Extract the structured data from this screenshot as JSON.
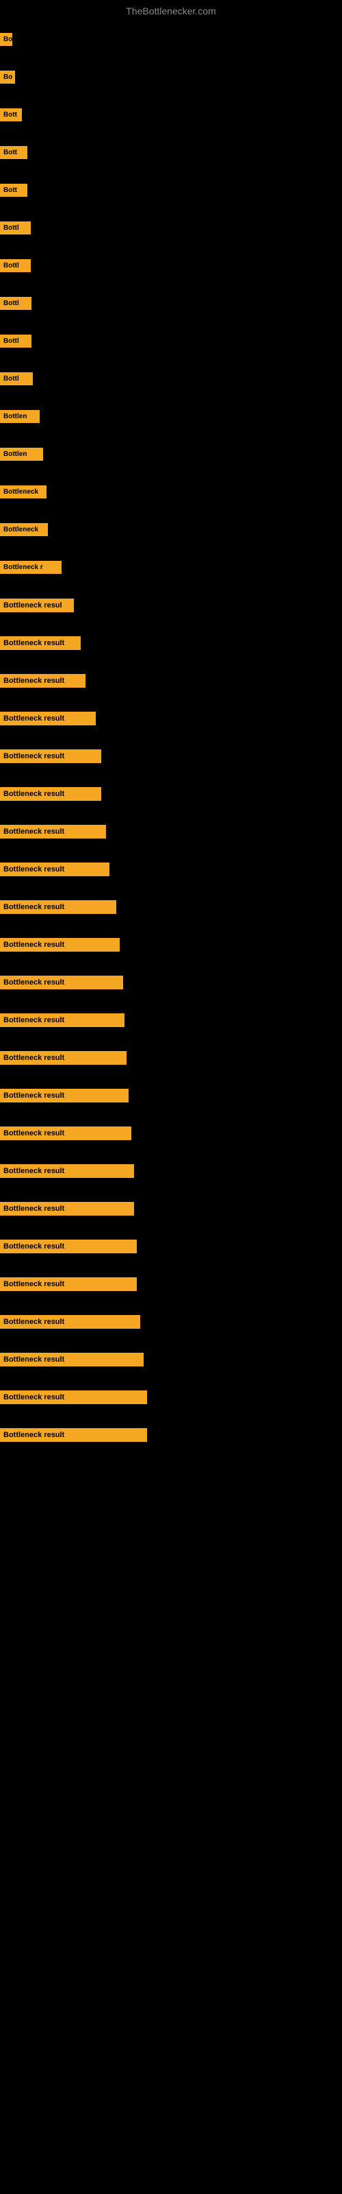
{
  "site": {
    "title": "TheBottlenecker.com"
  },
  "items": [
    {
      "id": 1,
      "label": "Bo"
    },
    {
      "id": 2,
      "label": "Bo"
    },
    {
      "id": 3,
      "label": "Bott"
    },
    {
      "id": 4,
      "label": "Bott"
    },
    {
      "id": 5,
      "label": "Bott"
    },
    {
      "id": 6,
      "label": "Bottl"
    },
    {
      "id": 7,
      "label": "Bottl"
    },
    {
      "id": 8,
      "label": "Bottl"
    },
    {
      "id": 9,
      "label": "Bottl"
    },
    {
      "id": 10,
      "label": "Bottl"
    },
    {
      "id": 11,
      "label": "Bottlen"
    },
    {
      "id": 12,
      "label": "Bottlen"
    },
    {
      "id": 13,
      "label": "Bottleneck"
    },
    {
      "id": 14,
      "label": "Bottleneck"
    },
    {
      "id": 15,
      "label": "Bottleneck r"
    },
    {
      "id": 16,
      "label": "Bottleneck resul"
    },
    {
      "id": 17,
      "label": "Bottleneck result"
    },
    {
      "id": 18,
      "label": "Bottleneck result"
    },
    {
      "id": 19,
      "label": "Bottleneck result"
    },
    {
      "id": 20,
      "label": "Bottleneck result"
    },
    {
      "id": 21,
      "label": "Bottleneck result"
    },
    {
      "id": 22,
      "label": "Bottleneck result"
    },
    {
      "id": 23,
      "label": "Bottleneck result"
    },
    {
      "id": 24,
      "label": "Bottleneck result"
    },
    {
      "id": 25,
      "label": "Bottleneck result"
    },
    {
      "id": 26,
      "label": "Bottleneck result"
    },
    {
      "id": 27,
      "label": "Bottleneck result"
    },
    {
      "id": 28,
      "label": "Bottleneck result"
    },
    {
      "id": 29,
      "label": "Bottleneck result"
    },
    {
      "id": 30,
      "label": "Bottleneck result"
    },
    {
      "id": 31,
      "label": "Bottleneck result"
    },
    {
      "id": 32,
      "label": "Bottleneck result"
    },
    {
      "id": 33,
      "label": "Bottleneck result"
    },
    {
      "id": 34,
      "label": "Bottleneck result"
    },
    {
      "id": 35,
      "label": "Bottleneck result"
    },
    {
      "id": 36,
      "label": "Bottleneck result"
    },
    {
      "id": 37,
      "label": "Bottleneck result"
    },
    {
      "id": 38,
      "label": "Bottleneck result"
    }
  ]
}
